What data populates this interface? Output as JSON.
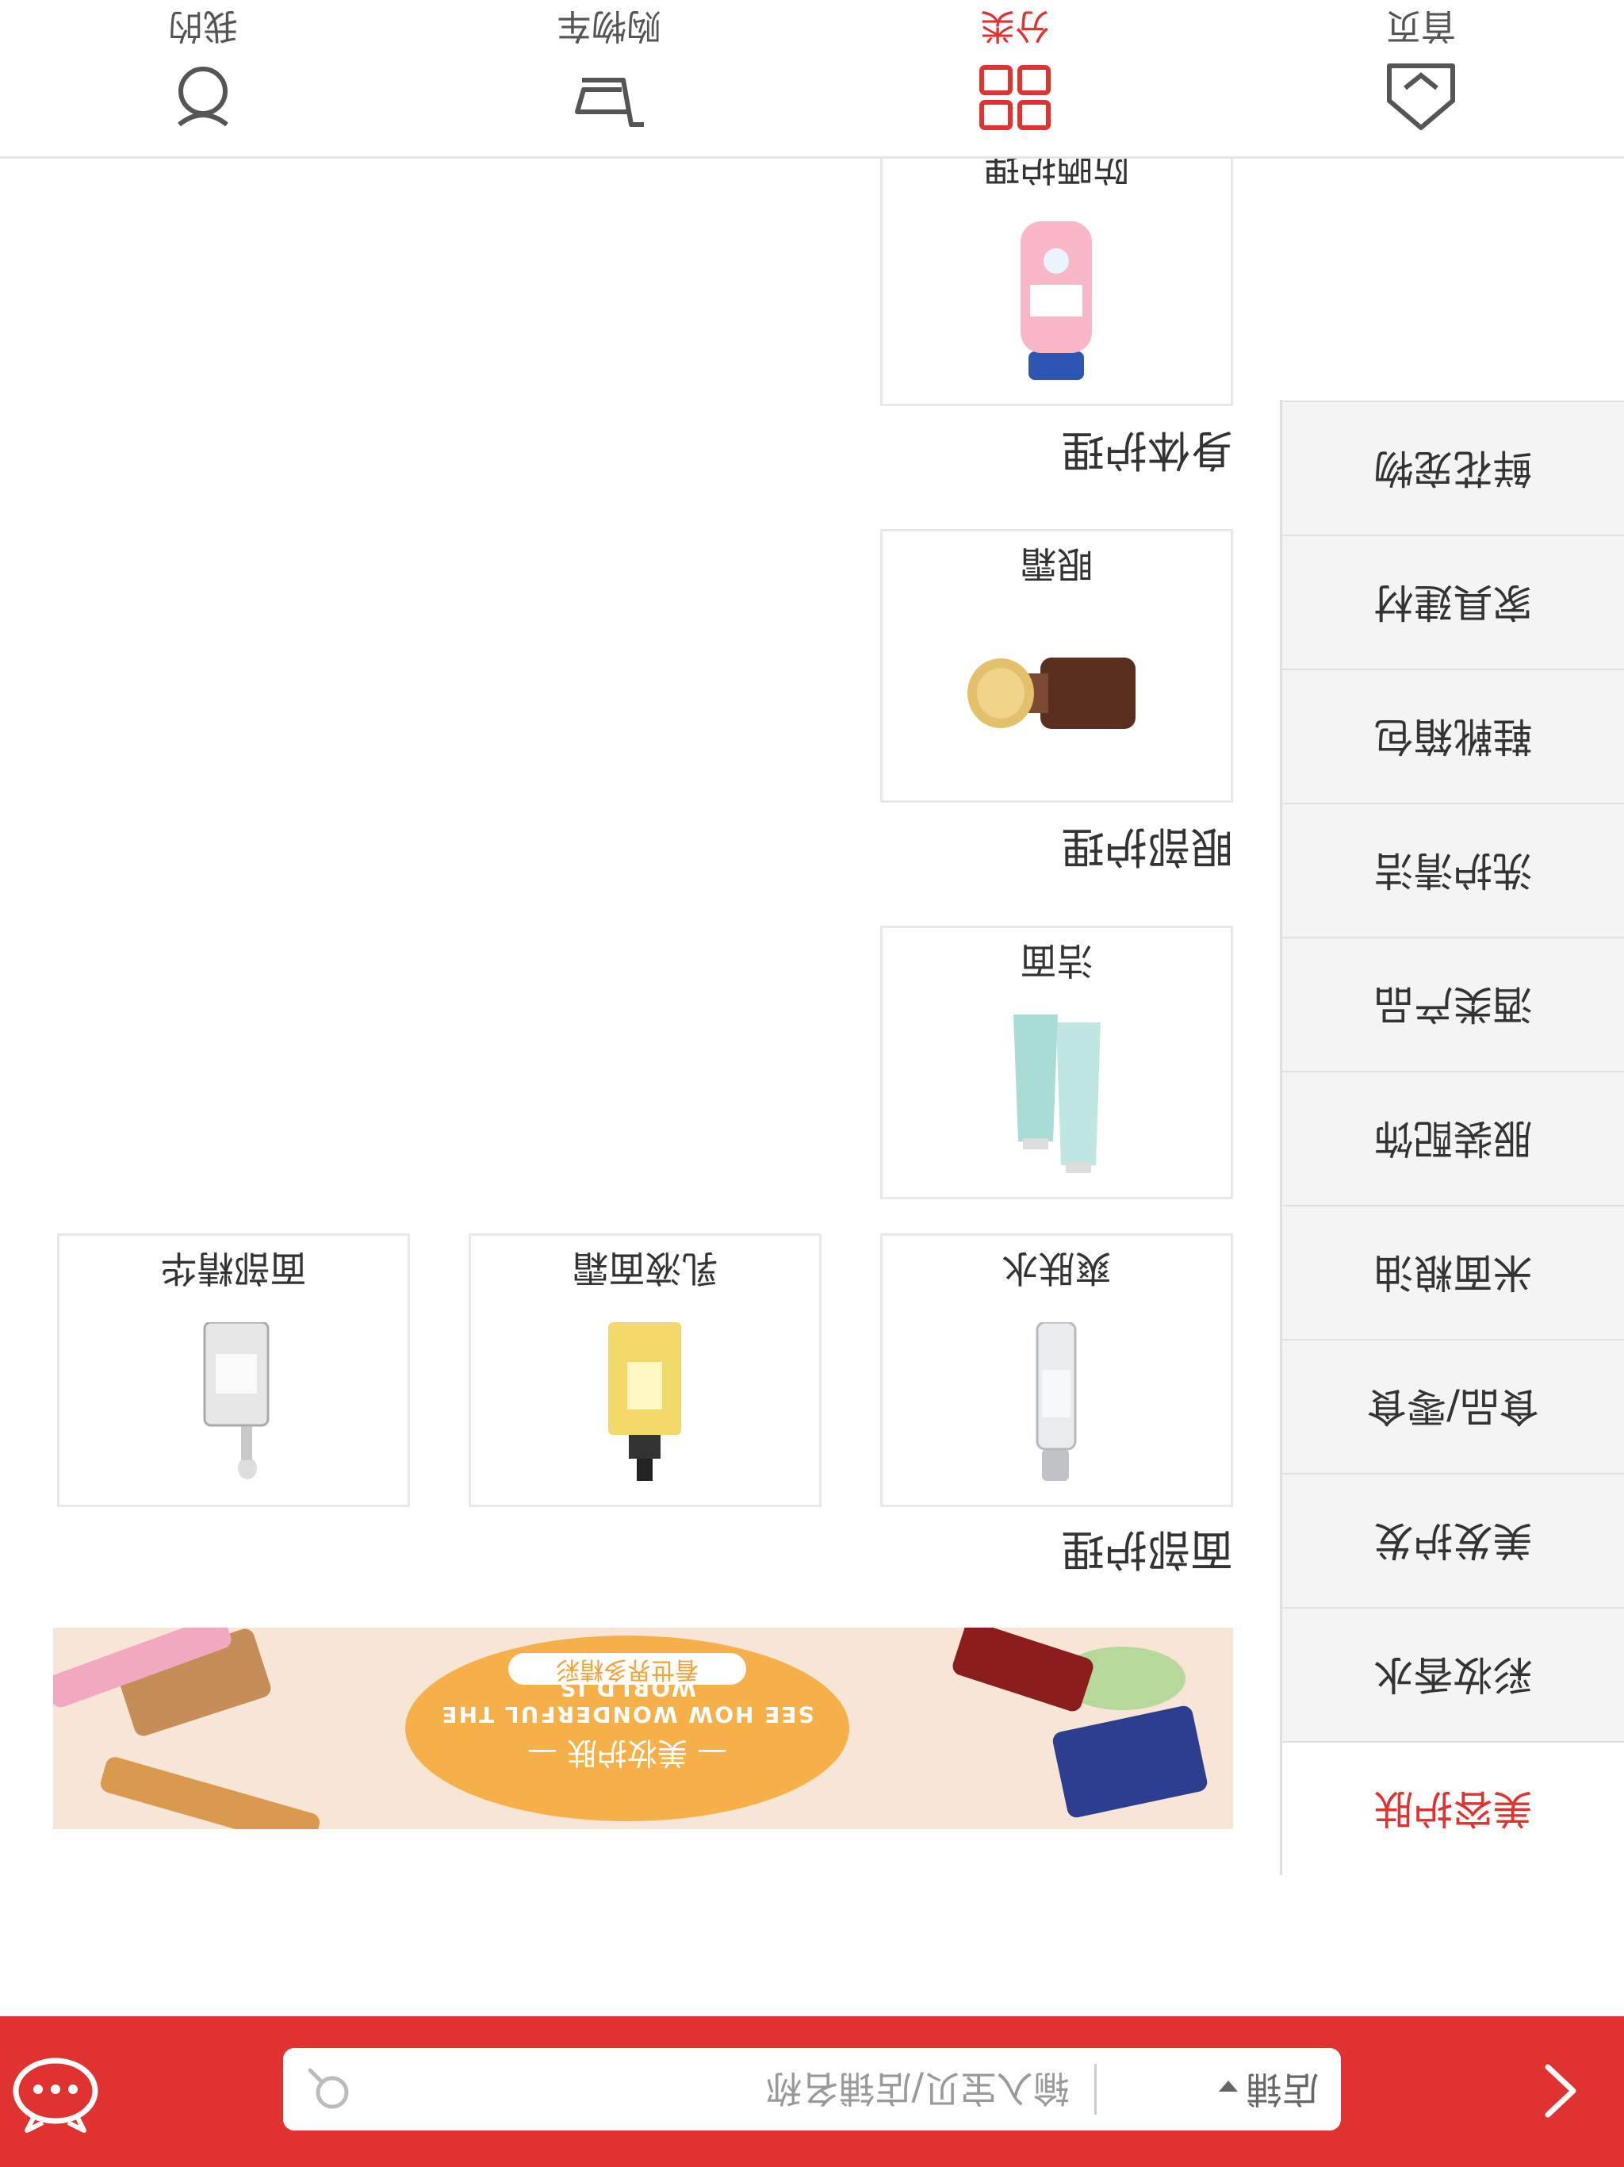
{
  "header": {
    "scope_label": "店铺",
    "search_placeholder": "输入宝贝/店铺名称"
  },
  "sidebar": {
    "items": [
      {
        "label": "美容护肤",
        "active": true
      },
      {
        "label": "彩妆香水"
      },
      {
        "label": "美发护发"
      },
      {
        "label": "食品/零食"
      },
      {
        "label": "米面粮油"
      },
      {
        "label": "服装配饰"
      },
      {
        "label": "酒类产品"
      },
      {
        "label": "洗护清洁"
      },
      {
        "label": "鞋靴箱包"
      },
      {
        "label": "家具建材"
      },
      {
        "label": "鲜花宠物"
      }
    ]
  },
  "banner": {
    "title": "— 美妆护肤 —",
    "subtitle_en": "SEE HOW WONDERFUL THE WORLD IS",
    "tag": "看世界多精彩"
  },
  "sections": [
    {
      "title": "面部护理",
      "items": [
        {
          "label": "爽肤水",
          "icon": "toner-bottle"
        },
        {
          "label": "乳液面霜",
          "icon": "lotion-pump"
        },
        {
          "label": "面部精华",
          "icon": "serum-dropper"
        },
        {
          "label": "洁面",
          "icon": "cleanser-tubes"
        }
      ]
    },
    {
      "title": "眼部护理",
      "items": [
        {
          "label": "眼霜",
          "icon": "eye-cream-jar"
        }
      ]
    },
    {
      "title": "身体护理",
      "items": [
        {
          "label": "防晒护理",
          "icon": "sunscreen-bottle"
        }
      ]
    }
  ],
  "tabbar": {
    "items": [
      {
        "label": "首页",
        "icon": "home-icon"
      },
      {
        "label": "分类",
        "icon": "category-icon",
        "active": true
      },
      {
        "label": "购物车",
        "icon": "cart-icon"
      },
      {
        "label": "我的",
        "icon": "user-icon"
      }
    ]
  },
  "colors": {
    "accent": "#e13232",
    "sidebar_bg": "#f4f4f4",
    "banner_bg": "#f7e5d6",
    "banner_circle": "#f5b04a"
  }
}
